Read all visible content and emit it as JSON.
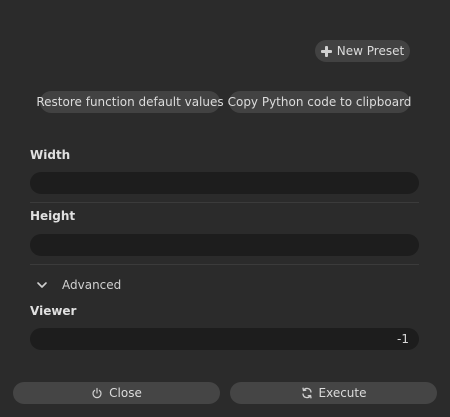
{
  "presets": {
    "new_preset_label": "New Preset",
    "icon": "plus-icon"
  },
  "actions": {
    "restore_label": "Restore function default values",
    "copy_label": "Copy Python code to clipboard"
  },
  "fields": {
    "width": {
      "label": "Width",
      "value": ""
    },
    "height": {
      "label": "Height",
      "value": ""
    }
  },
  "advanced": {
    "label": "Advanced",
    "icon": "chevron-down-icon",
    "expanded": true,
    "viewer": {
      "label": "Viewer",
      "value": "-1"
    }
  },
  "footer": {
    "close_label": "Close",
    "close_icon": "power-icon",
    "execute_label": "Execute",
    "execute_icon": "refresh-icon"
  }
}
